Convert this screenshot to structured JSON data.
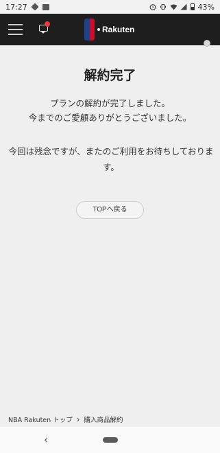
{
  "status_bar": {
    "time": "17:27",
    "battery": "43%",
    "icons": [
      "notification-hex-icon",
      "image-icon",
      "alarm-icon",
      "vibrate-icon",
      "wifi-icon",
      "signal-icon",
      "battery-icon"
    ]
  },
  "header": {
    "brand": "Rakuten",
    "menu_icon": "hamburger-icon",
    "chat_icon": "chat-icon",
    "user_icon": "user-icon"
  },
  "main": {
    "title": "解約完了",
    "message_line1": "プランの解約が完了しました。",
    "message_line2": "今までのご愛顧ありがとうございました。",
    "message_line3": "今回は残念ですが、またのご利用をお待ちしております。",
    "top_button_label": "TOPへ戻る"
  },
  "breadcrumb": {
    "items": [
      "NBA Rakuten トップ",
      "購入商品解約"
    ],
    "separator": "＞"
  },
  "nav_bar": {
    "back_icon": "‹"
  },
  "colors": {
    "header_bg": "#1e1e1e",
    "page_bg": "#efefef",
    "badge": "#e23c3c"
  }
}
